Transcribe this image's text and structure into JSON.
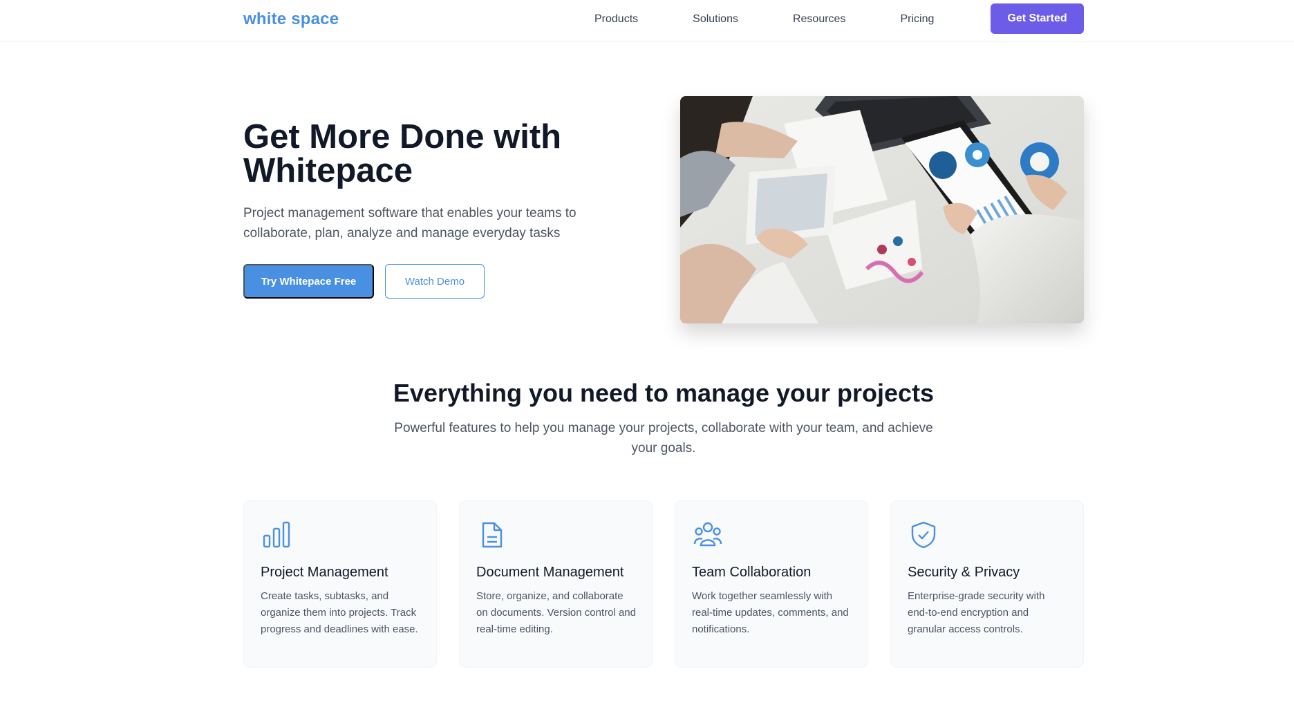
{
  "nav": {
    "logo": "white space",
    "links": [
      "Products",
      "Solutions",
      "Resources",
      "Pricing"
    ],
    "cta": "Get Started"
  },
  "hero": {
    "title": "Get More Done with Whitepace",
    "subtitle": "Project management software that enables your teams to collaborate, plan, analyze and manage everyday tasks",
    "primary_button": "Try Whitepace Free",
    "secondary_button": "Watch Demo"
  },
  "features": {
    "title": "Everything you need to manage your projects",
    "subtitle": "Powerful features to help you manage your projects, collaborate with your team, and achieve your goals.",
    "cards": [
      {
        "icon": "bar-chart-icon",
        "title": "Project Management",
        "text": "Create tasks, subtasks, and organize them into projects. Track progress and deadlines with ease."
      },
      {
        "icon": "document-icon",
        "title": "Document Management",
        "text": "Store, organize, and collaborate on documents. Version control and real-time editing."
      },
      {
        "icon": "team-icon",
        "title": "Team Collaboration",
        "text": "Work together seamlessly with real-time updates, comments, and notifications."
      },
      {
        "icon": "shield-check-icon",
        "title": "Security & Privacy",
        "text": "Enterprise-grade security with end-to-end encryption and granular access controls."
      }
    ]
  },
  "colors": {
    "brand": "#4a90e2",
    "cta": "#6c5ce7",
    "heading": "#111827",
    "body": "#4b5563"
  }
}
